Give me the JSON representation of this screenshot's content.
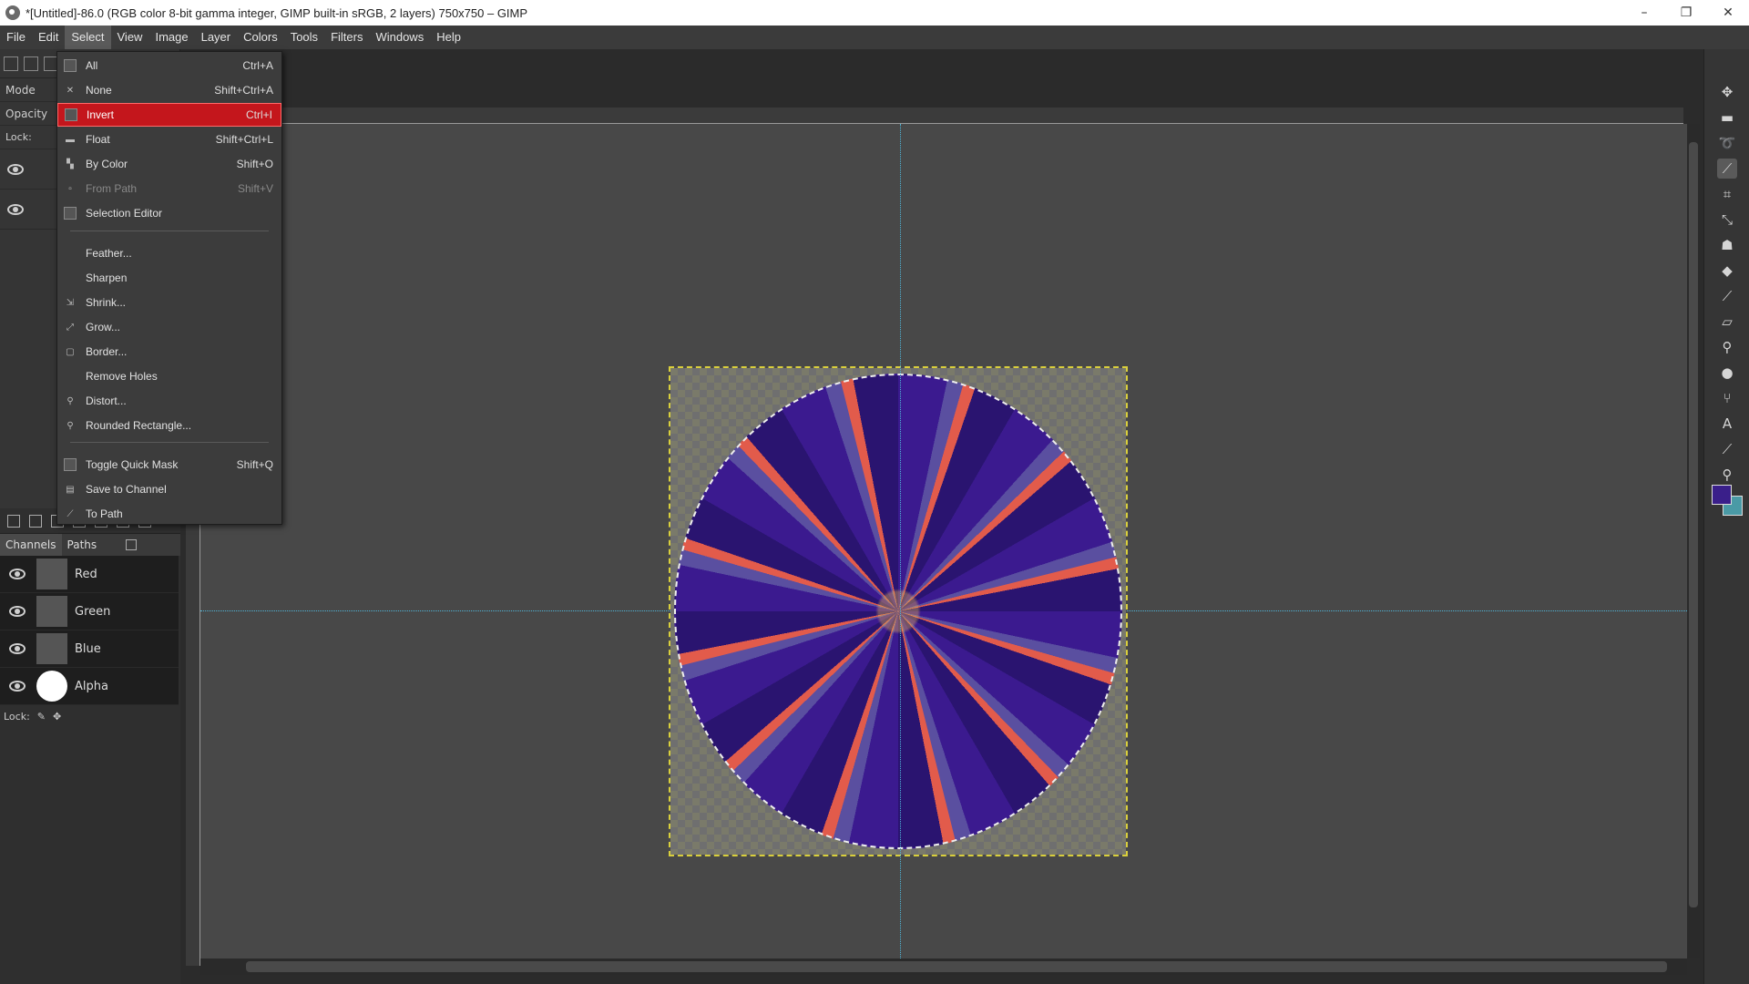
{
  "window": {
    "title": "*[Untitled]-86.0 (RGB color 8-bit gamma integer, GIMP built-in sRGB, 2 layers) 750x750 – GIMP",
    "controls": {
      "minimize": "–",
      "maximize": "❐",
      "close": "✕"
    }
  },
  "menubar": [
    "File",
    "Edit",
    "Select",
    "View",
    "Image",
    "Layer",
    "Colors",
    "Tools",
    "Filters",
    "Windows",
    "Help"
  ],
  "menubar_active": "Select",
  "left_dock": {
    "mode_label": "Mode",
    "opacity_label": "Opacity",
    "lock_label": "Lock:"
  },
  "select_menu": {
    "items": [
      {
        "label": "All",
        "shortcut": "Ctrl+A",
        "icon": "select-all-icon",
        "state": "normal"
      },
      {
        "label": "None",
        "shortcut": "Shift+Ctrl+A",
        "icon": "select-none-icon",
        "state": "normal"
      },
      {
        "label": "Invert",
        "shortcut": "Ctrl+I",
        "icon": "select-invert-icon",
        "state": "highlighted"
      },
      {
        "label": "Float",
        "shortcut": "Shift+Ctrl+L",
        "icon": "float-icon",
        "state": "normal"
      },
      {
        "label": "By Color",
        "shortcut": "Shift+O",
        "icon": "select-by-color-icon",
        "state": "normal"
      },
      {
        "label": "From Path",
        "shortcut": "Shift+V",
        "icon": "from-path-icon",
        "state": "disabled"
      },
      {
        "label": "Selection Editor",
        "shortcut": "",
        "icon": "selection-editor-icon",
        "state": "normal"
      },
      {
        "label": "Feather...",
        "shortcut": "",
        "icon": "",
        "state": "normal"
      },
      {
        "label": "Sharpen",
        "shortcut": "",
        "icon": "",
        "state": "normal"
      },
      {
        "label": "Shrink...",
        "shortcut": "",
        "icon": "shrink-icon",
        "state": "normal"
      },
      {
        "label": "Grow...",
        "shortcut": "",
        "icon": "grow-icon",
        "state": "normal"
      },
      {
        "label": "Border...",
        "shortcut": "",
        "icon": "border-icon",
        "state": "normal"
      },
      {
        "label": "Remove Holes",
        "shortcut": "",
        "icon": "",
        "state": "normal"
      },
      {
        "label": "Distort...",
        "shortcut": "",
        "icon": "distort-icon",
        "state": "normal"
      },
      {
        "label": "Rounded Rectangle...",
        "shortcut": "",
        "icon": "rounded-rectangle-icon",
        "state": "normal"
      },
      {
        "label": "Toggle Quick Mask",
        "shortcut": "Shift+Q",
        "icon": "quick-mask-icon",
        "state": "normal"
      },
      {
        "label": "Save to Channel",
        "shortcut": "",
        "icon": "save-channel-icon",
        "state": "normal"
      },
      {
        "label": "To Path",
        "shortcut": "",
        "icon": "to-path-icon",
        "state": "normal"
      }
    ]
  },
  "channels_panel": {
    "tabs": [
      "Channels",
      "Paths"
    ],
    "channels": [
      "Red",
      "Green",
      "Blue",
      "Alpha"
    ],
    "lock_label": "Lock:"
  },
  "colors": {
    "foreground": "#3a1f8a",
    "background": "#4a9aa6",
    "highlight": "#c4161c",
    "guide": "#4fb5d8"
  }
}
